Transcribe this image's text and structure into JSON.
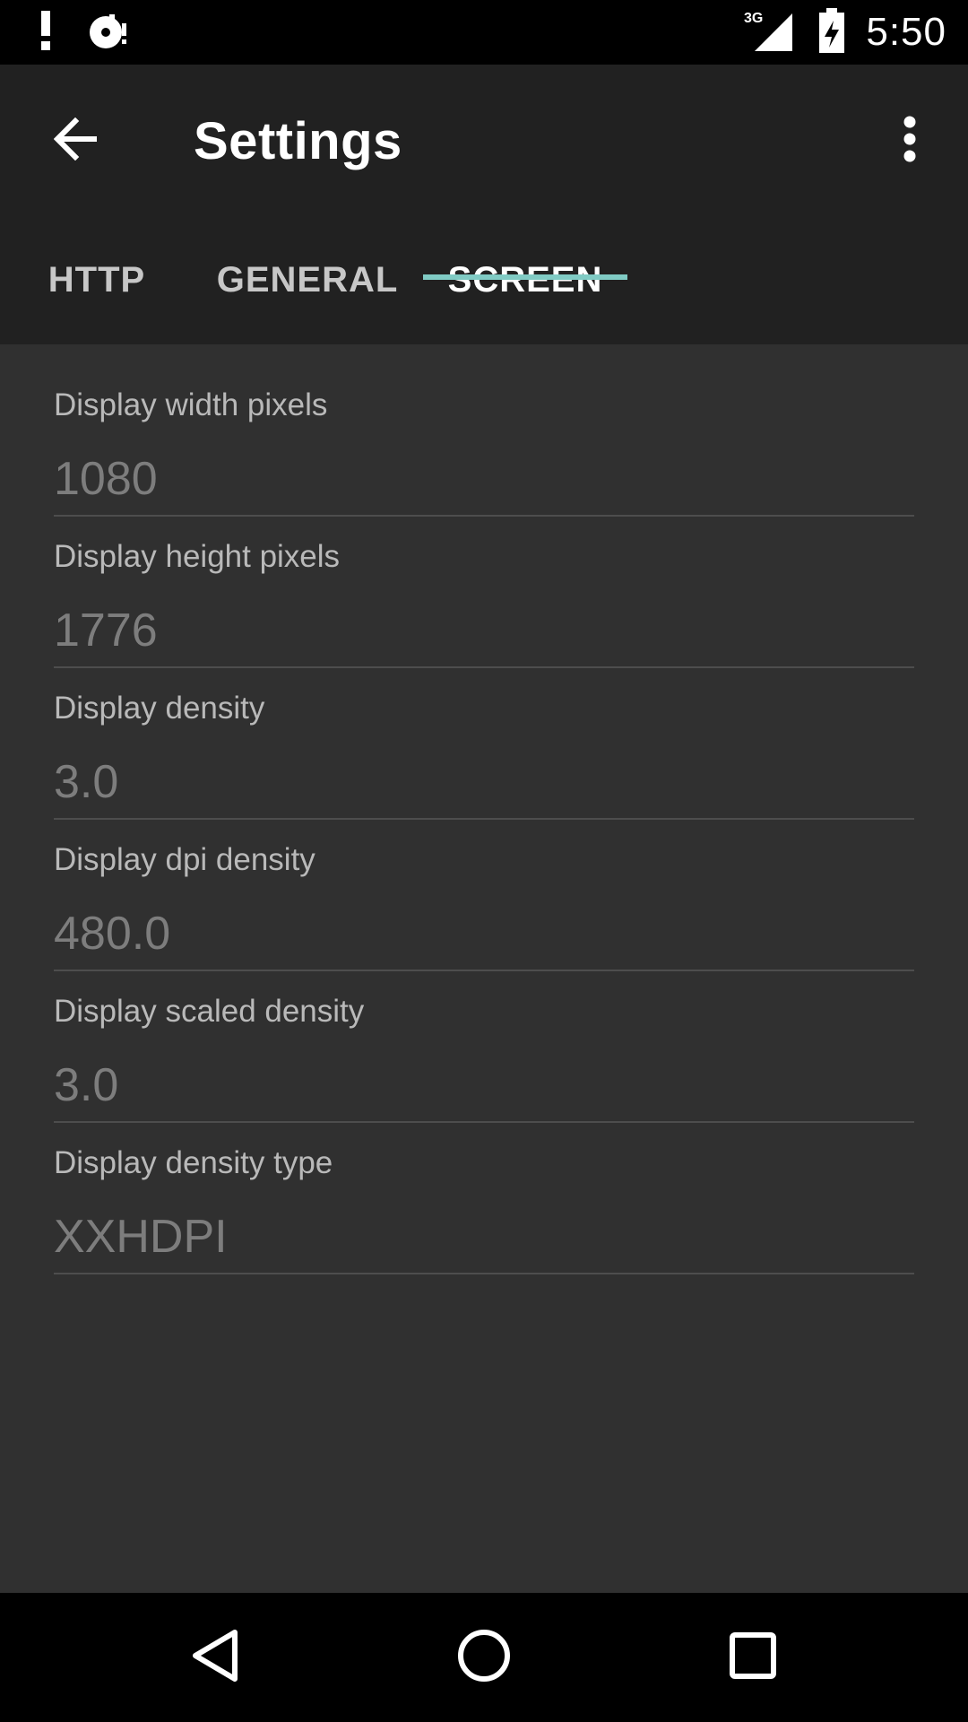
{
  "colors": {
    "status_bar": "#000000",
    "app_bar": "#212121",
    "background": "#303030",
    "accent": "#80cbc4"
  },
  "status_bar": {
    "time": "5:50",
    "network": "3G",
    "icons": [
      "alert-icon",
      "media-icon",
      "signal-icon",
      "battery-charging-icon"
    ]
  },
  "app_bar": {
    "title": "Settings",
    "back_icon": "arrow-back-icon",
    "more_icon": "more-vert-icon"
  },
  "tabs": [
    {
      "label": "HTTP",
      "selected": false
    },
    {
      "label": "GENERAL",
      "selected": false
    },
    {
      "label": "SCREEN",
      "selected": true
    }
  ],
  "fields": [
    {
      "label": "Display width pixels",
      "value": "1080"
    },
    {
      "label": "Display height pixels",
      "value": "1776"
    },
    {
      "label": "Display density",
      "value": "3.0"
    },
    {
      "label": "Display dpi density",
      "value": "480.0"
    },
    {
      "label": "Display scaled density",
      "value": "3.0"
    },
    {
      "label": "Display density type",
      "value": "XXHDPI"
    }
  ],
  "nav_bar": {
    "icons": [
      "nav-back-icon",
      "nav-home-icon",
      "nav-recents-icon"
    ]
  }
}
